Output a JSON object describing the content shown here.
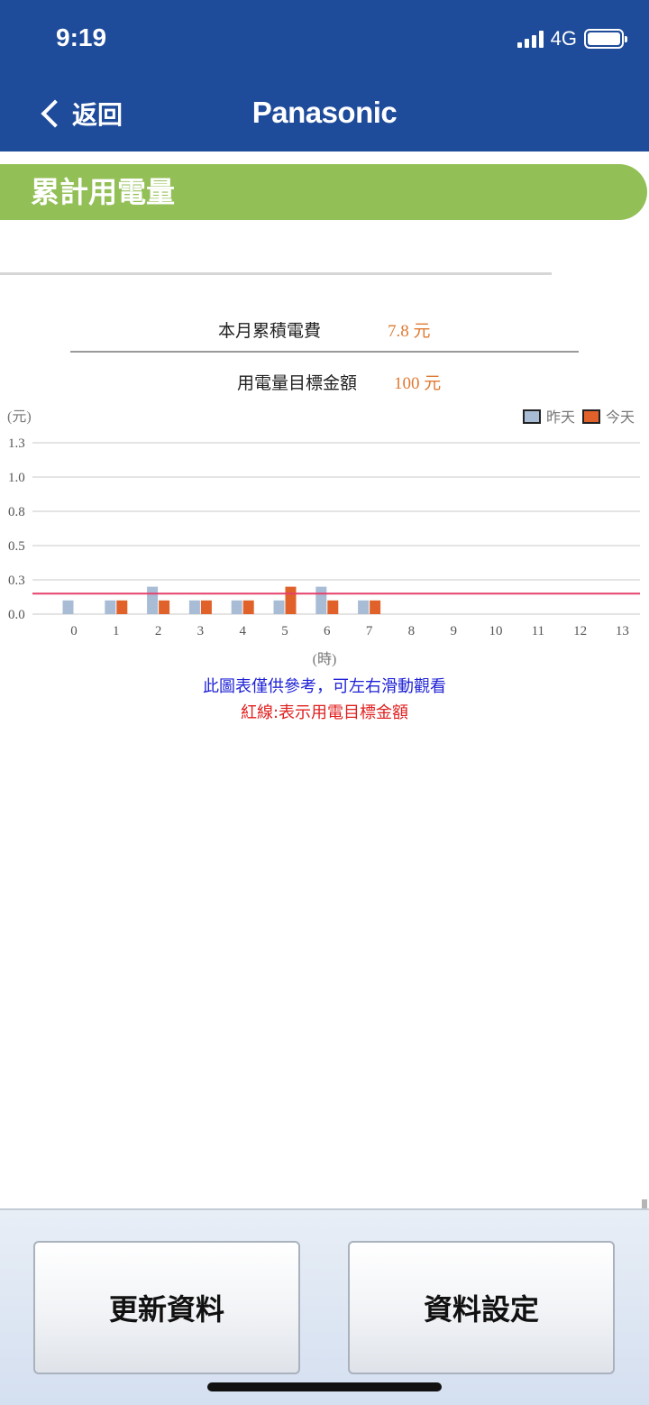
{
  "status_bar": {
    "time": "9:19",
    "network": "4G"
  },
  "nav": {
    "back_label": "返回",
    "brand": "Panasonic"
  },
  "section_title": "累計用電量",
  "summary": {
    "monthly_cost_label": "本月累積電費",
    "monthly_cost_value": "7.8 元",
    "target_label": "用電量目標金額",
    "target_value": "100 元"
  },
  "chart_data": {
    "type": "bar",
    "ylabel": "(元)",
    "xlabel": "(時)",
    "categories": [
      "0",
      "1",
      "2",
      "3",
      "4",
      "5",
      "6",
      "7",
      "8",
      "9",
      "10",
      "11",
      "12",
      "13"
    ],
    "yticks": [
      "0.0",
      "0.3",
      "0.5",
      "0.8",
      "1.0",
      "1.3"
    ],
    "ytick_values": [
      0.0,
      0.25,
      0.5,
      0.75,
      1.0,
      1.25
    ],
    "ylim": [
      0,
      1.25
    ],
    "series": [
      {
        "name": "昨天",
        "color": "#a8bcd6",
        "values": [
          0.1,
          0.1,
          0.2,
          0.1,
          0.1,
          0.1,
          0.2,
          0.1,
          null,
          null,
          null,
          null,
          null,
          null
        ]
      },
      {
        "name": "今天",
        "color": "#e0622a",
        "values": [
          null,
          0.1,
          0.1,
          0.1,
          0.1,
          0.2,
          0.1,
          0.1,
          null,
          null,
          null,
          null,
          null,
          null
        ]
      }
    ],
    "target_line": {
      "value": 0.15,
      "color": "#e5406a"
    },
    "legend_position": "top-right",
    "grid": true
  },
  "notes": {
    "scroll_hint": "此圖表僅供參考，可左右滑動觀看",
    "red_line_hint": "紅線:表示用電目標金額"
  },
  "buttons": {
    "refresh": "更新資料",
    "settings": "資料設定"
  }
}
